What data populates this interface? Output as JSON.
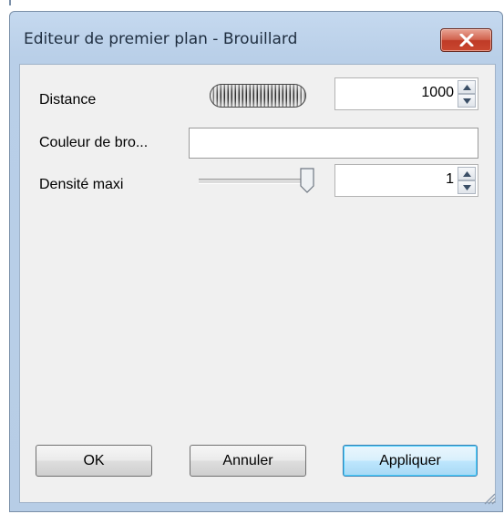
{
  "window": {
    "title": "Editeur de premier plan - Brouillard"
  },
  "fields": {
    "distance": {
      "label": "Distance",
      "value": "1000"
    },
    "couleur": {
      "label": "Couleur de bro...",
      "value": ""
    },
    "densite": {
      "label": "Densité maxi",
      "value": "1",
      "slider_level": 1.0
    }
  },
  "buttons": {
    "ok": "OK",
    "cancel": "Annuler",
    "apply": "Appliquer"
  },
  "colors": {
    "frame": "#b9cfe8",
    "client": "#f0f0f0",
    "close": "#c9462f",
    "default_button": "#3c7fb1"
  }
}
